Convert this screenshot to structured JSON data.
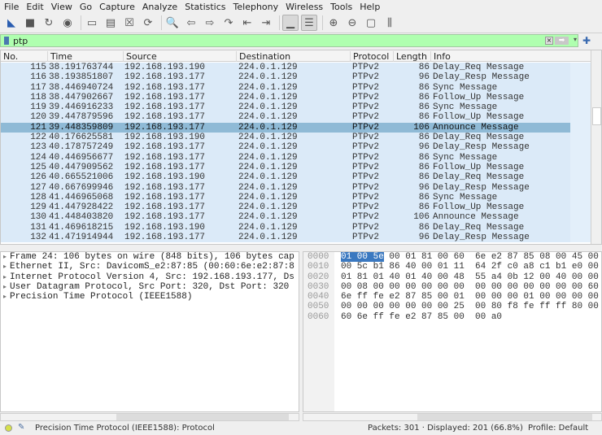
{
  "menu": [
    "File",
    "Edit",
    "View",
    "Go",
    "Capture",
    "Analyze",
    "Statistics",
    "Telephony",
    "Wireless",
    "Tools",
    "Help"
  ],
  "toolbar": [
    "shark-fin-start-icon",
    "stop-icon",
    "restart-icon",
    "options-icon",
    "open-icon",
    "save-icon",
    "close-file-icon",
    "reload-icon",
    "find-icon",
    "back-icon",
    "forward-icon",
    "goto-icon",
    "first-icon",
    "last-icon",
    "autoscroll-icon",
    "colorize-icon",
    "zoom-in-icon",
    "zoom-out-icon",
    "normal-size-icon",
    "resize-columns-icon"
  ],
  "filter": {
    "value": "ptp"
  },
  "columns": {
    "no": "No.",
    "time": "Time",
    "source": "Source",
    "destination": "Destination",
    "protocol": "Protocol",
    "length": "Length",
    "info": "Info"
  },
  "packets": [
    [
      "115",
      "38.191763744",
      "192.168.193.190",
      "224.0.1.129",
      "PTPv2",
      "86",
      "Delay_Req Message"
    ],
    [
      "116",
      "38.193851807",
      "192.168.193.177",
      "224.0.1.129",
      "PTPv2",
      "96",
      "Delay_Resp Message"
    ],
    [
      "117",
      "38.446940724",
      "192.168.193.177",
      "224.0.1.129",
      "PTPv2",
      "86",
      "Sync Message"
    ],
    [
      "118",
      "38.447902667",
      "192.168.193.177",
      "224.0.1.129",
      "PTPv2",
      "86",
      "Follow_Up Message"
    ],
    [
      "119",
      "39.446916233",
      "192.168.193.177",
      "224.0.1.129",
      "PTPv2",
      "86",
      "Sync Message"
    ],
    [
      "120",
      "39.447879596",
      "192.168.193.177",
      "224.0.1.129",
      "PTPv2",
      "86",
      "Follow_Up Message"
    ],
    [
      "121",
      "39.448359809",
      "192.168.193.177",
      "224.0.1.129",
      "PTPv2",
      "106",
      "Announce Message"
    ],
    [
      "122",
      "40.176625581",
      "192.168.193.190",
      "224.0.1.129",
      "PTPv2",
      "86",
      "Delay_Req Message"
    ],
    [
      "123",
      "40.178757249",
      "192.168.193.177",
      "224.0.1.129",
      "PTPv2",
      "96",
      "Delay_Resp Message"
    ],
    [
      "124",
      "40.446956677",
      "192.168.193.177",
      "224.0.1.129",
      "PTPv2",
      "86",
      "Sync Message"
    ],
    [
      "125",
      "40.447909562",
      "192.168.193.177",
      "224.0.1.129",
      "PTPv2",
      "86",
      "Follow_Up Message"
    ],
    [
      "126",
      "40.665521006",
      "192.168.193.190",
      "224.0.1.129",
      "PTPv2",
      "86",
      "Delay_Req Message"
    ],
    [
      "127",
      "40.667699946",
      "192.168.193.177",
      "224.0.1.129",
      "PTPv2",
      "96",
      "Delay_Resp Message"
    ],
    [
      "128",
      "41.446965068",
      "192.168.193.177",
      "224.0.1.129",
      "PTPv2",
      "86",
      "Sync Message"
    ],
    [
      "129",
      "41.447928422",
      "192.168.193.177",
      "224.0.1.129",
      "PTPv2",
      "86",
      "Follow_Up Message"
    ],
    [
      "130",
      "41.448403820",
      "192.168.193.177",
      "224.0.1.129",
      "PTPv2",
      "106",
      "Announce Message"
    ],
    [
      "131",
      "41.469618215",
      "192.168.193.190",
      "224.0.1.129",
      "PTPv2",
      "86",
      "Delay_Req Message"
    ],
    [
      "132",
      "41.471914944",
      "192.168.193.177",
      "224.0.1.129",
      "PTPv2",
      "96",
      "Delay_Resp Message"
    ]
  ],
  "selected_packet": "121",
  "details": [
    "Frame 24: 106 bytes on wire (848 bits), 106 bytes cap",
    "Ethernet II, Src: DavicomS_e2:87:85 (00:60:6e:e2:87:8",
    "Internet Protocol Version 4, Src: 192.168.193.177, Ds",
    "User Datagram Protocol, Src Port: 320, Dst Port: 320",
    "Precision Time Protocol (IEEE1588)"
  ],
  "hex": {
    "offsets": [
      "0000",
      "0010",
      "0020",
      "0030",
      "0040",
      "0050",
      "0060"
    ],
    "selected": "01 00 5e",
    "lines": [
      " 00 01 81 00 60  6e e2 87 85 08 00 45 00",
      "00 5c b1 86 40 00 01 11  64 2f c0 a8 c1 b1 e0 00",
      "01 81 01 40 01 40 00 48  55 a4 0b 12 00 40 00 00",
      "00 08 00 00 00 00 00 00  00 00 00 00 00 00 00 60",
      "6e ff fe e2 87 85 00 01  00 00 00 01 00 00 00 00",
      "00 00 00 00 00 00 00 25  00 80 f8 fe ff ff 80 00",
      "60 6e ff fe e2 87 85 00  00 a0"
    ]
  },
  "status": {
    "message": "Precision Time Protocol (IEEE1588): Protocol",
    "packets": "Packets: 301 · Displayed: 201 (66.8%)",
    "profile": "Profile: Default"
  },
  "colors": {
    "filter_ok": "#afffaf",
    "row": "#dbeaf8",
    "row_selected": "#8fbad6",
    "hex_selected": "#3a78c0"
  }
}
